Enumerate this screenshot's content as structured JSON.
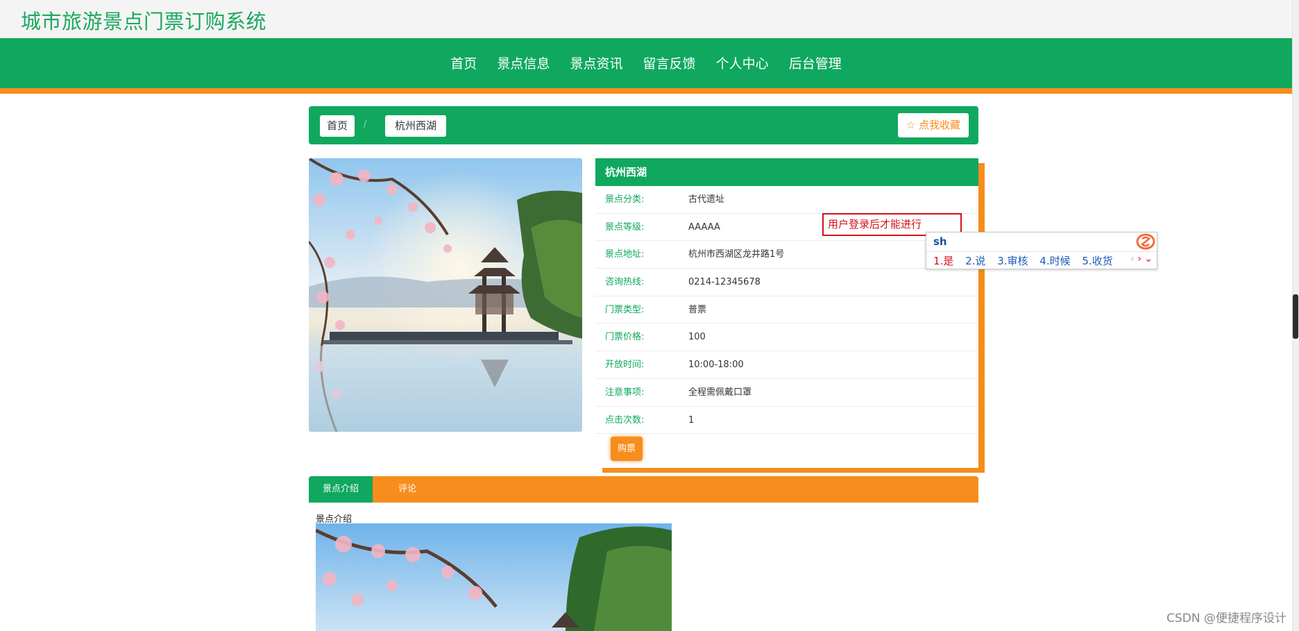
{
  "site": {
    "title": "城市旅游景点门票订购系统"
  },
  "nav": {
    "items": [
      "首页",
      "景点信息",
      "景点资讯",
      "留言反馈",
      "个人中心",
      "后台管理"
    ]
  },
  "breadcrumb": {
    "home": "首页",
    "separator": "/",
    "current": "杭州西湖",
    "favorite_label": "☆ 点我收藏"
  },
  "detail": {
    "title": "杭州西湖",
    "rows": [
      {
        "label": "景点分类:",
        "value": "古代遗址"
      },
      {
        "label": "景点等级:",
        "value": "AAAAA"
      },
      {
        "label": "景点地址:",
        "value": "杭州市西湖区龙井路1号"
      },
      {
        "label": "咨询热线:",
        "value": "0214-12345678"
      },
      {
        "label": "门票类型:",
        "value": "普票"
      },
      {
        "label": "门票价格:",
        "value": "100"
      },
      {
        "label": "开放时间:",
        "value": "10:00-18:00"
      },
      {
        "label": "注意事项:",
        "value": "全程需佩戴口罩"
      },
      {
        "label": "点击次数:",
        "value": "1"
      }
    ],
    "buy_label": "购票"
  },
  "tip": {
    "text": "用户登录后才能进行"
  },
  "ime": {
    "input": "sh",
    "candidates": [
      "1.是",
      "2.说",
      "3.审核",
      "4.时候",
      "5.收货"
    ]
  },
  "tabs": {
    "active": "景点介绍",
    "other": "评论"
  },
  "intro": {
    "label": "景点介绍"
  },
  "watermark": "CSDN @便捷程序设计",
  "colors": {
    "green": "#0fa85e",
    "orange": "#f68d1c",
    "tip_red": "#d3111b"
  },
  "icons": [
    "star-icon",
    "sogou-logo-icon",
    "chevron-left-icon",
    "chevron-right-icon",
    "chevron-down-icon"
  ]
}
